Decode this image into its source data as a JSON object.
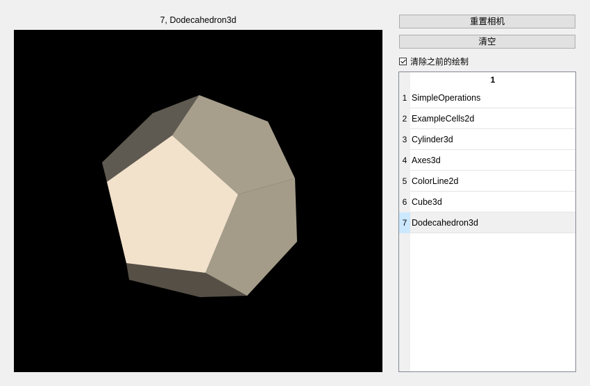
{
  "viewport": {
    "title": "7, Dodecahedron3d"
  },
  "controls": {
    "reset_camera_label": "重置相机",
    "clear_label": "清空",
    "clear_previous_label": "清除之前的绘制",
    "clear_previous_checked": true
  },
  "table": {
    "column_header": "1",
    "rows": [
      {
        "num": "1",
        "name": "SimpleOperations"
      },
      {
        "num": "2",
        "name": "ExampleCells2d"
      },
      {
        "num": "3",
        "name": "Cylinder3d"
      },
      {
        "num": "4",
        "name": "Axes3d"
      },
      {
        "num": "5",
        "name": "ColorLine2d"
      },
      {
        "num": "6",
        "name": "Cube3d"
      },
      {
        "num": "7",
        "name": "Dodecahedron3d"
      }
    ],
    "selected_row": 7
  },
  "colors": {
    "viewport_bg": "#000000",
    "face_front": "#f2e2cc",
    "face_top": "#a79f8c",
    "face_right": "#a49c89",
    "face_left": "#5f5a51",
    "face_bottom": "#554f46",
    "selection_rowhead": "#cce8ff"
  }
}
